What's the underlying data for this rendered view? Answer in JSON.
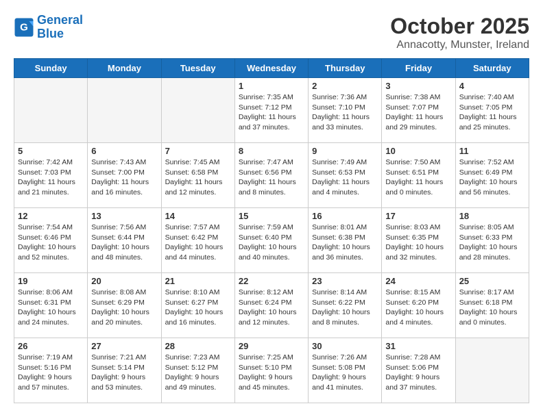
{
  "logo": {
    "line1": "General",
    "line2": "Blue"
  },
  "title": "October 2025",
  "subtitle": "Annacotty, Munster, Ireland",
  "days_of_week": [
    "Sunday",
    "Monday",
    "Tuesday",
    "Wednesday",
    "Thursday",
    "Friday",
    "Saturday"
  ],
  "weeks": [
    [
      {
        "day": "",
        "empty": true
      },
      {
        "day": "",
        "empty": true
      },
      {
        "day": "",
        "empty": true
      },
      {
        "day": "1",
        "sunrise": "7:35 AM",
        "sunset": "7:12 PM",
        "daylight": "11 hours and 37 minutes."
      },
      {
        "day": "2",
        "sunrise": "7:36 AM",
        "sunset": "7:10 PM",
        "daylight": "11 hours and 33 minutes."
      },
      {
        "day": "3",
        "sunrise": "7:38 AM",
        "sunset": "7:07 PM",
        "daylight": "11 hours and 29 minutes."
      },
      {
        "day": "4",
        "sunrise": "7:40 AM",
        "sunset": "7:05 PM",
        "daylight": "11 hours and 25 minutes."
      }
    ],
    [
      {
        "day": "5",
        "sunrise": "7:42 AM",
        "sunset": "7:03 PM",
        "daylight": "11 hours and 21 minutes."
      },
      {
        "day": "6",
        "sunrise": "7:43 AM",
        "sunset": "7:00 PM",
        "daylight": "11 hours and 16 minutes."
      },
      {
        "day": "7",
        "sunrise": "7:45 AM",
        "sunset": "6:58 PM",
        "daylight": "11 hours and 12 minutes."
      },
      {
        "day": "8",
        "sunrise": "7:47 AM",
        "sunset": "6:56 PM",
        "daylight": "11 hours and 8 minutes."
      },
      {
        "day": "9",
        "sunrise": "7:49 AM",
        "sunset": "6:53 PM",
        "daylight": "11 hours and 4 minutes."
      },
      {
        "day": "10",
        "sunrise": "7:50 AM",
        "sunset": "6:51 PM",
        "daylight": "11 hours and 0 minutes."
      },
      {
        "day": "11",
        "sunrise": "7:52 AM",
        "sunset": "6:49 PM",
        "daylight": "10 hours and 56 minutes."
      }
    ],
    [
      {
        "day": "12",
        "sunrise": "7:54 AM",
        "sunset": "6:46 PM",
        "daylight": "10 hours and 52 minutes."
      },
      {
        "day": "13",
        "sunrise": "7:56 AM",
        "sunset": "6:44 PM",
        "daylight": "10 hours and 48 minutes."
      },
      {
        "day": "14",
        "sunrise": "7:57 AM",
        "sunset": "6:42 PM",
        "daylight": "10 hours and 44 minutes."
      },
      {
        "day": "15",
        "sunrise": "7:59 AM",
        "sunset": "6:40 PM",
        "daylight": "10 hours and 40 minutes."
      },
      {
        "day": "16",
        "sunrise": "8:01 AM",
        "sunset": "6:38 PM",
        "daylight": "10 hours and 36 minutes."
      },
      {
        "day": "17",
        "sunrise": "8:03 AM",
        "sunset": "6:35 PM",
        "daylight": "10 hours and 32 minutes."
      },
      {
        "day": "18",
        "sunrise": "8:05 AM",
        "sunset": "6:33 PM",
        "daylight": "10 hours and 28 minutes."
      }
    ],
    [
      {
        "day": "19",
        "sunrise": "8:06 AM",
        "sunset": "6:31 PM",
        "daylight": "10 hours and 24 minutes."
      },
      {
        "day": "20",
        "sunrise": "8:08 AM",
        "sunset": "6:29 PM",
        "daylight": "10 hours and 20 minutes."
      },
      {
        "day": "21",
        "sunrise": "8:10 AM",
        "sunset": "6:27 PM",
        "daylight": "10 hours and 16 minutes."
      },
      {
        "day": "22",
        "sunrise": "8:12 AM",
        "sunset": "6:24 PM",
        "daylight": "10 hours and 12 minutes."
      },
      {
        "day": "23",
        "sunrise": "8:14 AM",
        "sunset": "6:22 PM",
        "daylight": "10 hours and 8 minutes."
      },
      {
        "day": "24",
        "sunrise": "8:15 AM",
        "sunset": "6:20 PM",
        "daylight": "10 hours and 4 minutes."
      },
      {
        "day": "25",
        "sunrise": "8:17 AM",
        "sunset": "6:18 PM",
        "daylight": "10 hours and 0 minutes."
      }
    ],
    [
      {
        "day": "26",
        "sunrise": "7:19 AM",
        "sunset": "5:16 PM",
        "daylight": "9 hours and 57 minutes."
      },
      {
        "day": "27",
        "sunrise": "7:21 AM",
        "sunset": "5:14 PM",
        "daylight": "9 hours and 53 minutes."
      },
      {
        "day": "28",
        "sunrise": "7:23 AM",
        "sunset": "5:12 PM",
        "daylight": "9 hours and 49 minutes."
      },
      {
        "day": "29",
        "sunrise": "7:25 AM",
        "sunset": "5:10 PM",
        "daylight": "9 hours and 45 minutes."
      },
      {
        "day": "30",
        "sunrise": "7:26 AM",
        "sunset": "5:08 PM",
        "daylight": "9 hours and 41 minutes."
      },
      {
        "day": "31",
        "sunrise": "7:28 AM",
        "sunset": "5:06 PM",
        "daylight": "9 hours and 37 minutes."
      },
      {
        "day": "",
        "empty": true
      }
    ]
  ]
}
